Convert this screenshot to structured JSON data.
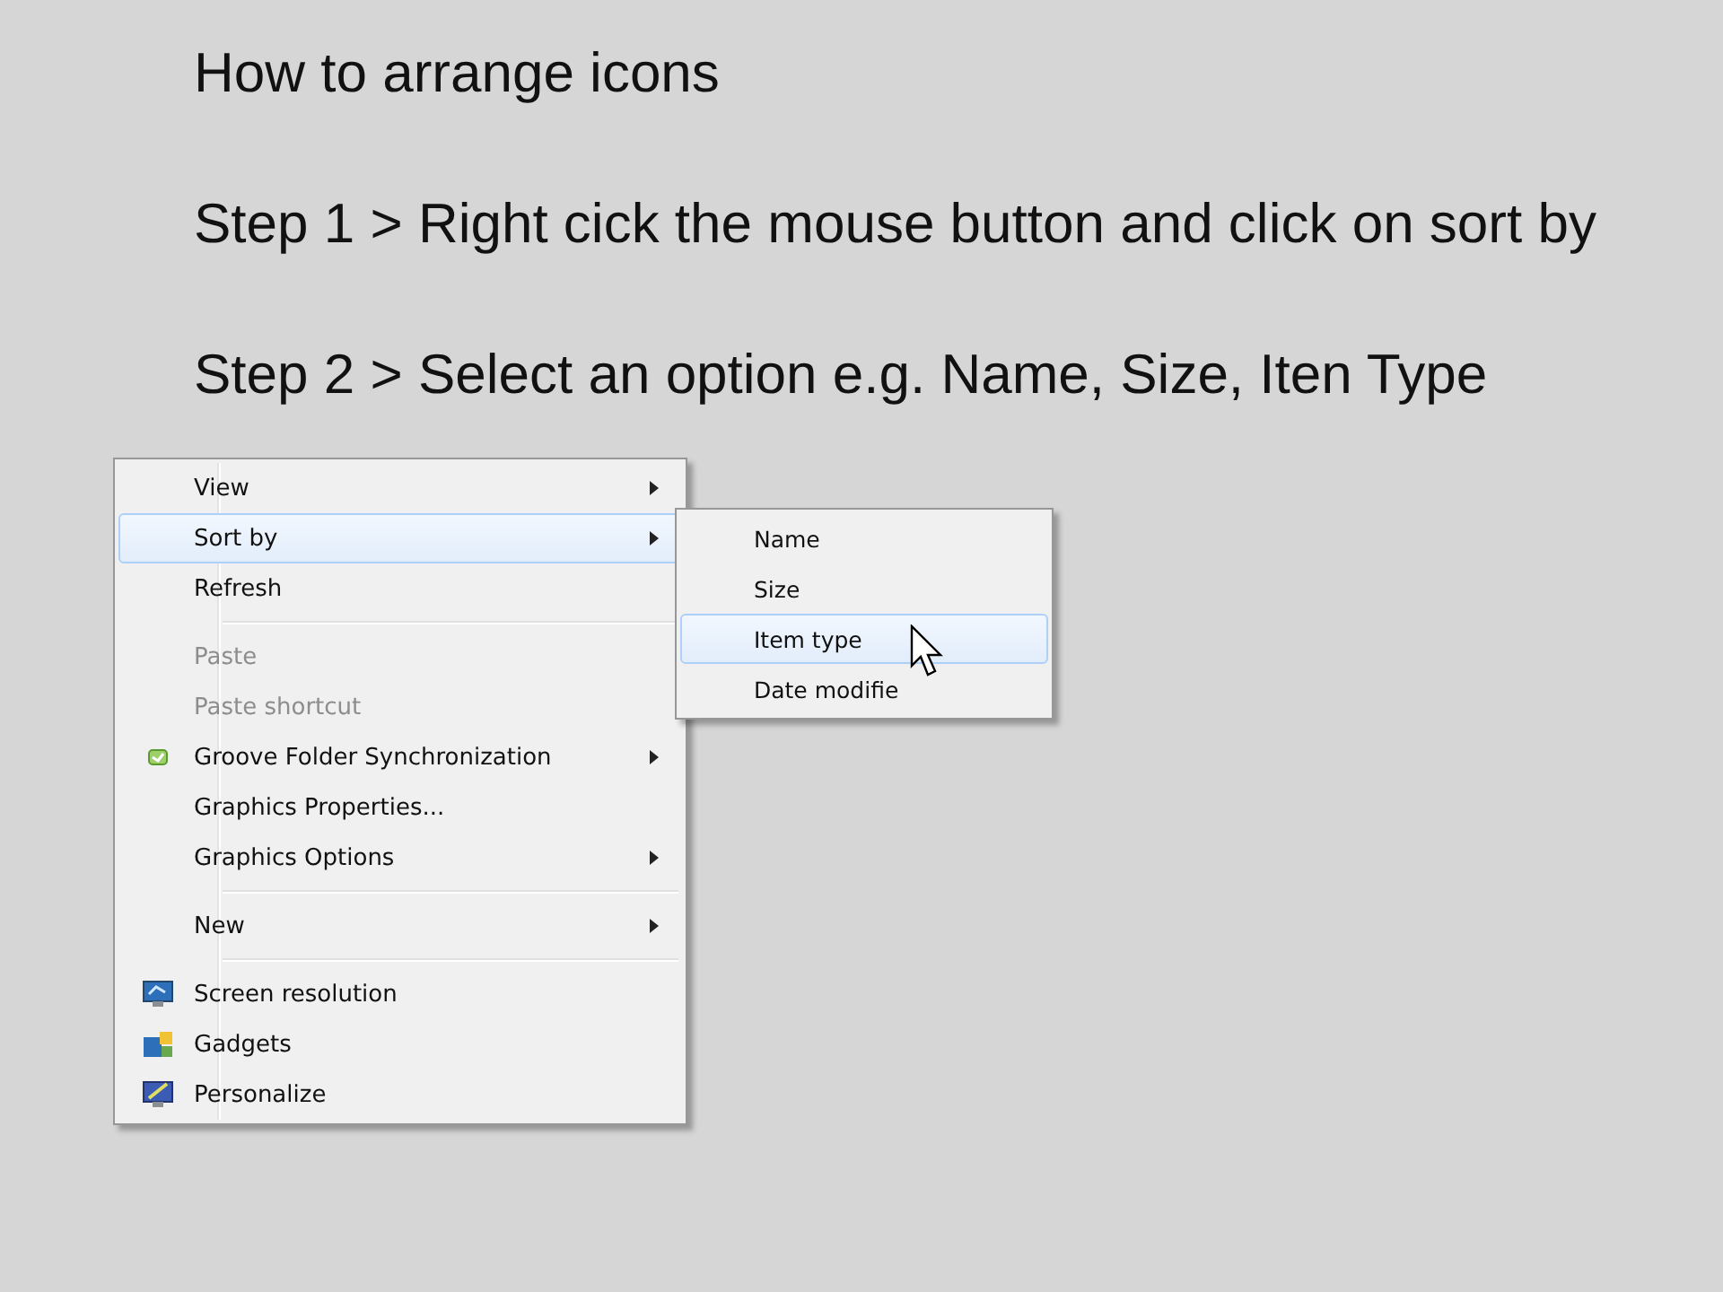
{
  "slide": {
    "title": "How to arrange icons",
    "steps": [
      "Step 1 > Right cick the mouse button and click on sort by",
      "Step 2 > Select an option e.g. Name,  Size, Iten Type"
    ]
  },
  "context_menu": {
    "items": [
      {
        "kind": "item",
        "label": "View",
        "disabled": false,
        "selected": false,
        "submenu": true
      },
      {
        "kind": "item",
        "label": "Sort by",
        "disabled": false,
        "selected": true,
        "submenu": true
      },
      {
        "kind": "item",
        "label": "Refresh",
        "disabled": false,
        "selected": false,
        "submenu": false
      },
      {
        "kind": "separator"
      },
      {
        "kind": "item",
        "label": "Paste",
        "disabled": true,
        "selected": false,
        "submenu": false
      },
      {
        "kind": "item",
        "label": "Paste shortcut",
        "disabled": true,
        "selected": false,
        "submenu": false
      },
      {
        "kind": "item",
        "label": "Groove Folder Synchronization",
        "disabled": false,
        "selected": false,
        "submenu": true
      },
      {
        "kind": "item",
        "label": "Graphics Properties...",
        "disabled": false,
        "selected": false,
        "submenu": false
      },
      {
        "kind": "item",
        "label": "Graphics Options",
        "disabled": false,
        "selected": false,
        "submenu": true
      },
      {
        "kind": "separator"
      },
      {
        "kind": "item",
        "label": "New",
        "disabled": false,
        "selected": false,
        "submenu": true
      },
      {
        "kind": "separator"
      },
      {
        "kind": "item",
        "label": "Screen resolution",
        "disabled": false,
        "selected": false,
        "submenu": false
      },
      {
        "kind": "item",
        "label": "Gadgets",
        "disabled": false,
        "selected": false,
        "submenu": false
      },
      {
        "kind": "item",
        "label": "Personalize",
        "disabled": false,
        "selected": false,
        "submenu": false
      }
    ]
  },
  "submenu": {
    "items": [
      {
        "label": "Name",
        "selected": false
      },
      {
        "label": "Size",
        "selected": false
      },
      {
        "label": "Item type",
        "selected": true
      },
      {
        "label": "Date modifie",
        "selected": false
      }
    ]
  }
}
